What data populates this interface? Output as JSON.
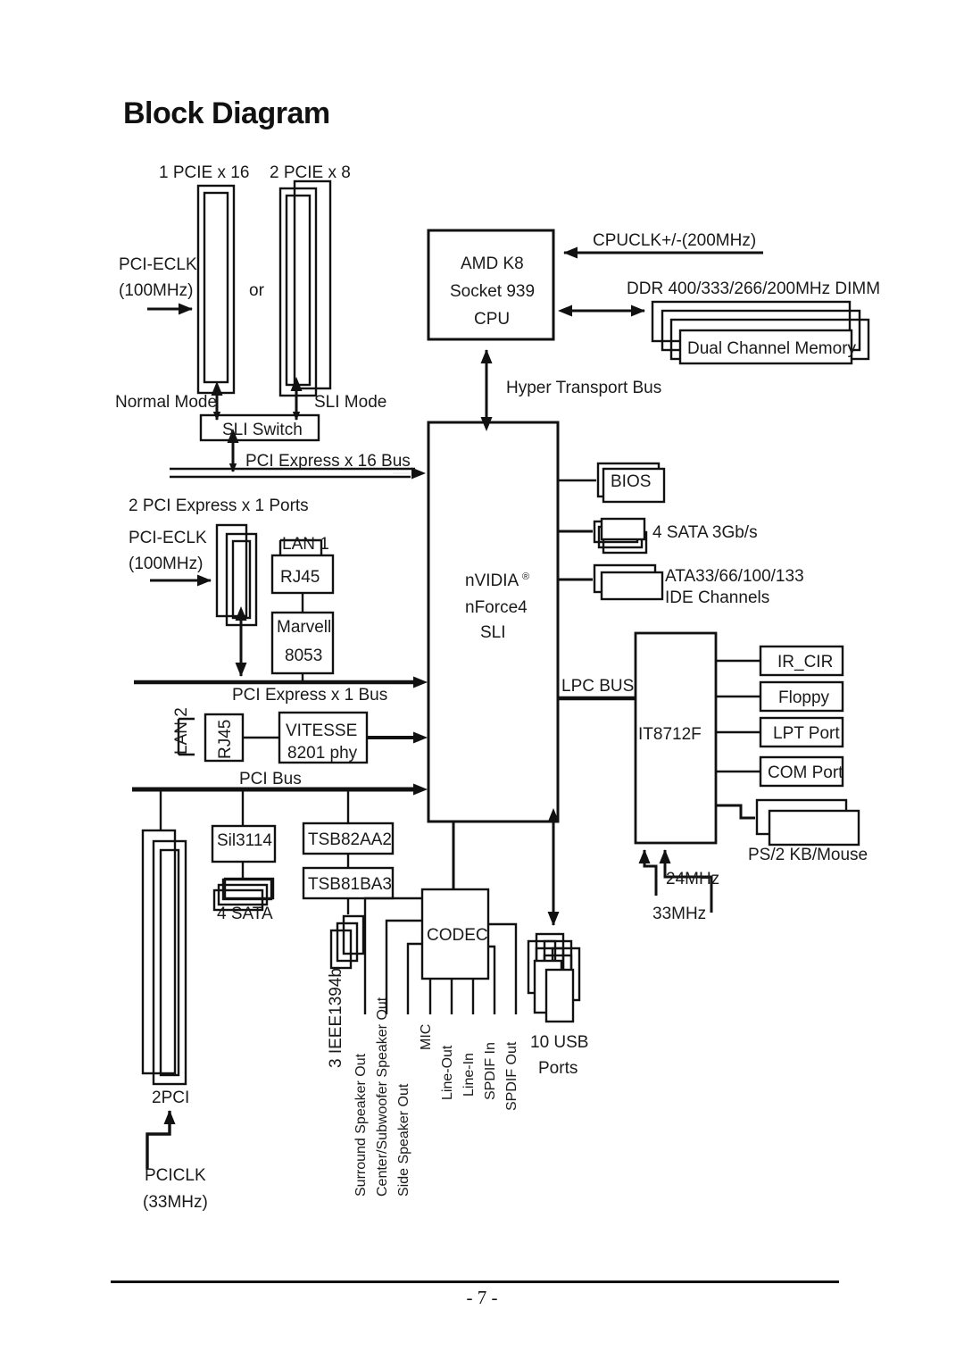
{
  "page": {
    "title": "Block Diagram",
    "page_number": "- 7 -"
  },
  "chart_data": {
    "type": "diagram",
    "title": "Block Diagram",
    "description": "Motherboard block diagram for an nVIDIA nForce4 SLI based AMD Socket 939 mainboard",
    "blocks": [
      {
        "id": "cpu",
        "label": "AMD K8 / Socket 939 / CPU"
      },
      {
        "id": "nforce4",
        "label": "nVIDIA nForce4 SLI"
      },
      {
        "id": "it8712f",
        "label": "IT8712F"
      },
      {
        "id": "codec",
        "label": "CODEC"
      },
      {
        "id": "sli_switch",
        "label": "SLI Switch"
      },
      {
        "id": "marvell",
        "label": "Marvell 8053"
      },
      {
        "id": "vitesse",
        "label": "VITESSE 8201 phy"
      },
      {
        "id": "sil3114",
        "label": "Sil3114"
      },
      {
        "id": "tsb82aa2",
        "label": "TSB82AA2"
      },
      {
        "id": "tsb81ba3",
        "label": "TSB81BA3"
      }
    ],
    "buses": [
      "PCI Express x 16 Bus",
      "PCI Express x 1 Bus",
      "PCI Bus",
      "Hyper Transport Bus",
      "LPC BUS"
    ]
  },
  "slots": {
    "pcie16_label": "1 PCIE x 16",
    "pcie8_label": "2 PCIE x 8",
    "or_label": "or",
    "normal_mode": "Normal Mode",
    "sli_mode": "SLI Mode",
    "sli_switch": "SLI Switch",
    "pcie1_ports": "2 PCI Express x 1 Ports",
    "pci_slots": "2PCI"
  },
  "clocks": {
    "pci_eclk_1": "PCI-ECLK",
    "pci_eclk_1_freq": "(100MHz)",
    "pci_eclk_2": "PCI-ECLK",
    "pci_eclk_2_freq": "(100MHz)",
    "cpuclk": "CPUCLK+/-(200MHz)",
    "pciclk": "PCICLK",
    "pciclk_freq": "(33MHz)",
    "clk_24mhz": "24MHz",
    "clk_33mhz": "33MHz"
  },
  "cpu": {
    "line1": "AMD K8",
    "line2": "Socket 939",
    "line3": "CPU"
  },
  "memory": {
    "header": "DDR 400/333/266/200MHz DIMM",
    "label": "Dual Channel Memory"
  },
  "chipset": {
    "line1": "nVIDIA",
    "sup": "®",
    "line2": "nForce4",
    "line3": "SLI"
  },
  "buses": {
    "hyper_transport": "Hyper Transport Bus",
    "pcie16": "PCI Express x 16 Bus",
    "pcie1": "PCI Express x 1 Bus",
    "pci": "PCI Bus",
    "lpc": "LPC BUS"
  },
  "southbridge_peripherals": {
    "bios": "BIOS",
    "sata": "4 SATA 3Gb/s",
    "ide_line1": "ATA33/66/100/133",
    "ide_line2": "IDE Channels"
  },
  "lan": {
    "lan1_label": "LAN 1",
    "lan1_rj45": "RJ45",
    "lan1_phy_line1": "Marvell",
    "lan1_phy_line2": "8053",
    "lan2_label": "LAN 2",
    "lan2_rj45": "RJ45",
    "lan2_phy_line1": "VITESSE",
    "lan2_phy_line2": "8201 phy"
  },
  "storage": {
    "sil3114": "Sil3114",
    "sata_label": "4 SATA"
  },
  "firewire": {
    "tsb82aa2": "TSB82AA2",
    "tsb81ba3": "TSB81BA3",
    "ports_label": "3 IEEE1394b"
  },
  "io_controller": {
    "name": "IT8712F",
    "ports": [
      {
        "label": "IR_CIR"
      },
      {
        "label": "Floppy"
      },
      {
        "label": "LPT Port"
      },
      {
        "label": "COM Port"
      }
    ],
    "ps2_label": "PS/2 KB/Mouse"
  },
  "audio": {
    "codec": "CODEC",
    "jacks": [
      "Surround Speaker Out",
      "Center/Subwoofer Speaker Out",
      "Side Speaker Out",
      "MIC",
      "Line-Out",
      "Line-In",
      "SPDIF In",
      "SPDIF Out"
    ]
  },
  "usb": {
    "line1": "10 USB",
    "line2": "Ports"
  }
}
